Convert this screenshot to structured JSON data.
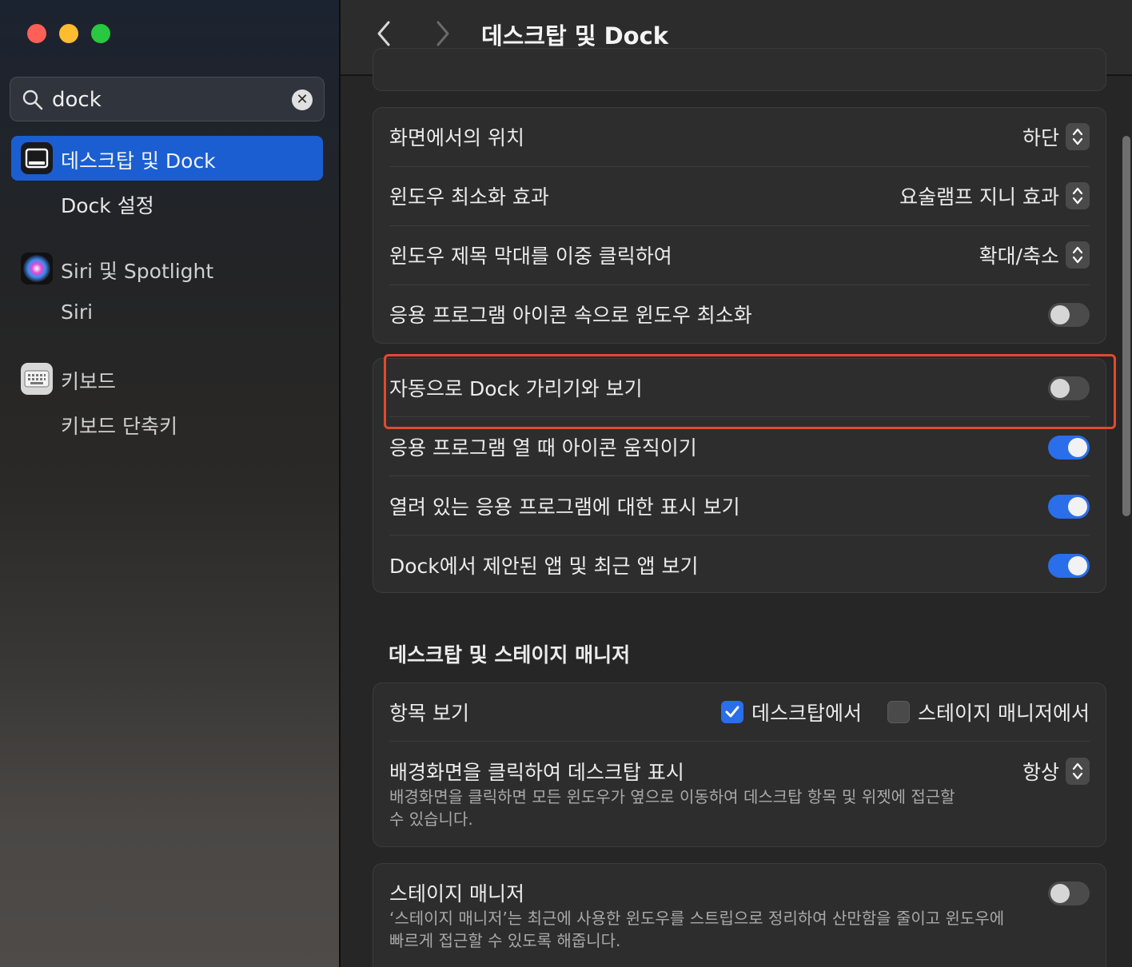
{
  "window": {
    "title": "데스크탑 및 Dock"
  },
  "sidebar": {
    "search": {
      "value": "dock",
      "placeholder": "검색"
    },
    "items": [
      {
        "label": "데스크탑 및 Dock",
        "selected": true,
        "icon": "desktop-dock-icon"
      },
      {
        "label": "Dock 설정",
        "sub": true
      },
      {
        "label": "Siri 및 Spotlight",
        "icon": "siri-icon"
      },
      {
        "label": "Siri",
        "sub": true
      },
      {
        "label": "키보드",
        "icon": "keyboard-icon"
      },
      {
        "label": "키보드 단축키",
        "sub": true
      }
    ]
  },
  "dock_card": {
    "rows": [
      {
        "label": "화면에서의 위치",
        "type": "popup",
        "value": "하단"
      },
      {
        "label": "윈도우 최소화 효과",
        "type": "popup",
        "value": "요술램프 지니 효과"
      },
      {
        "label": "윈도우 제목 막대를 이중 클릭하여",
        "type": "popup",
        "value": "확대/축소"
      },
      {
        "label": "응용 프로그램 아이콘 속으로 윈도우 최소화",
        "type": "toggle",
        "on": false
      }
    ]
  },
  "dock_card2": {
    "rows": [
      {
        "label": "자동으로 Dock 가리기와 보기",
        "type": "toggle",
        "on": false
      },
      {
        "label": "응용 프로그램 열 때 아이콘 움직이기",
        "type": "toggle",
        "on": true
      },
      {
        "label": "열려 있는 응용 프로그램에 대한 표시 보기",
        "type": "toggle",
        "on": true
      },
      {
        "label": "Dock에서 제안된 앱 및 최근 앱 보기",
        "type": "toggle",
        "on": true
      }
    ]
  },
  "stage_section": {
    "heading": "데스크탑 및 스테이지 매니저",
    "show_items": {
      "label": "항목 보기",
      "opt_desktop": "데스크탑에서",
      "opt_desktop_checked": true,
      "opt_stage": "스테이지 매니저에서",
      "opt_stage_checked": false
    },
    "click_wallpaper": {
      "label": "배경화면을 클릭하여 데스크탑 표시",
      "value": "항상",
      "desc_line1": "배경화면을 클릭하면 모든 윈도우가 옆으로 이동하여 데스크탑 항목 및 위젯에 접근할",
      "desc_line2": "수 있습니다."
    },
    "stage_manager": {
      "label": "스테이지 매니저",
      "on": false,
      "desc_line1": "‘스테이지 매니저’는 최근에 사용한 윈도우를 스트립으로 정리하여 산만함을 줄이고 윈도우에",
      "desc_line2": "빠르게 접근할 수 있도록 해줍니다."
    }
  },
  "colors": {
    "accent": "#2a6ee9",
    "highlight_border": "#e3492f",
    "sidebar_selected": "#1b5ed1"
  }
}
